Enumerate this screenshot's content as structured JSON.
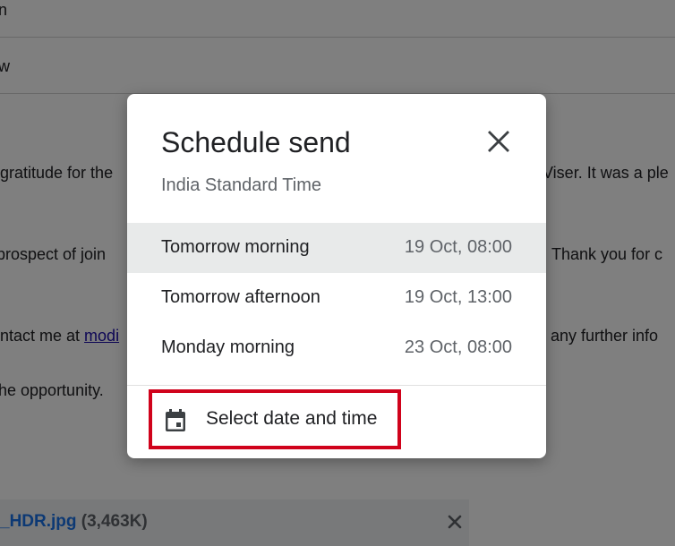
{
  "background": {
    "lines": [
      "n",
      "w",
      "gratitude for the",
      "Viser. It was a ple",
      "prospect of join",
      "Thank you for c",
      "ntact me at ",
      "modi",
      "any further info",
      "he opportunity."
    ],
    "attachment": {
      "name": "_HDR.jpg",
      "size": "(3,463K)"
    }
  },
  "dialog": {
    "title": "Schedule send",
    "subtitle": "India Standard Time",
    "options": [
      {
        "label": "Tomorrow morning",
        "time": "19 Oct, 08:00",
        "highlighted": true
      },
      {
        "label": "Tomorrow afternoon",
        "time": "19 Oct, 13:00",
        "highlighted": false
      },
      {
        "label": "Monday morning",
        "time": "23 Oct, 08:00",
        "highlighted": false
      }
    ],
    "select_date_time": {
      "label": "Select date and time",
      "icon": "calendar-icon"
    },
    "close_icon": "close-icon"
  },
  "colors": {
    "highlight": "#e8eaea",
    "annotation_border": "#d0021b",
    "link": "#1a0dab",
    "attachment_name": "#1a73e8"
  }
}
